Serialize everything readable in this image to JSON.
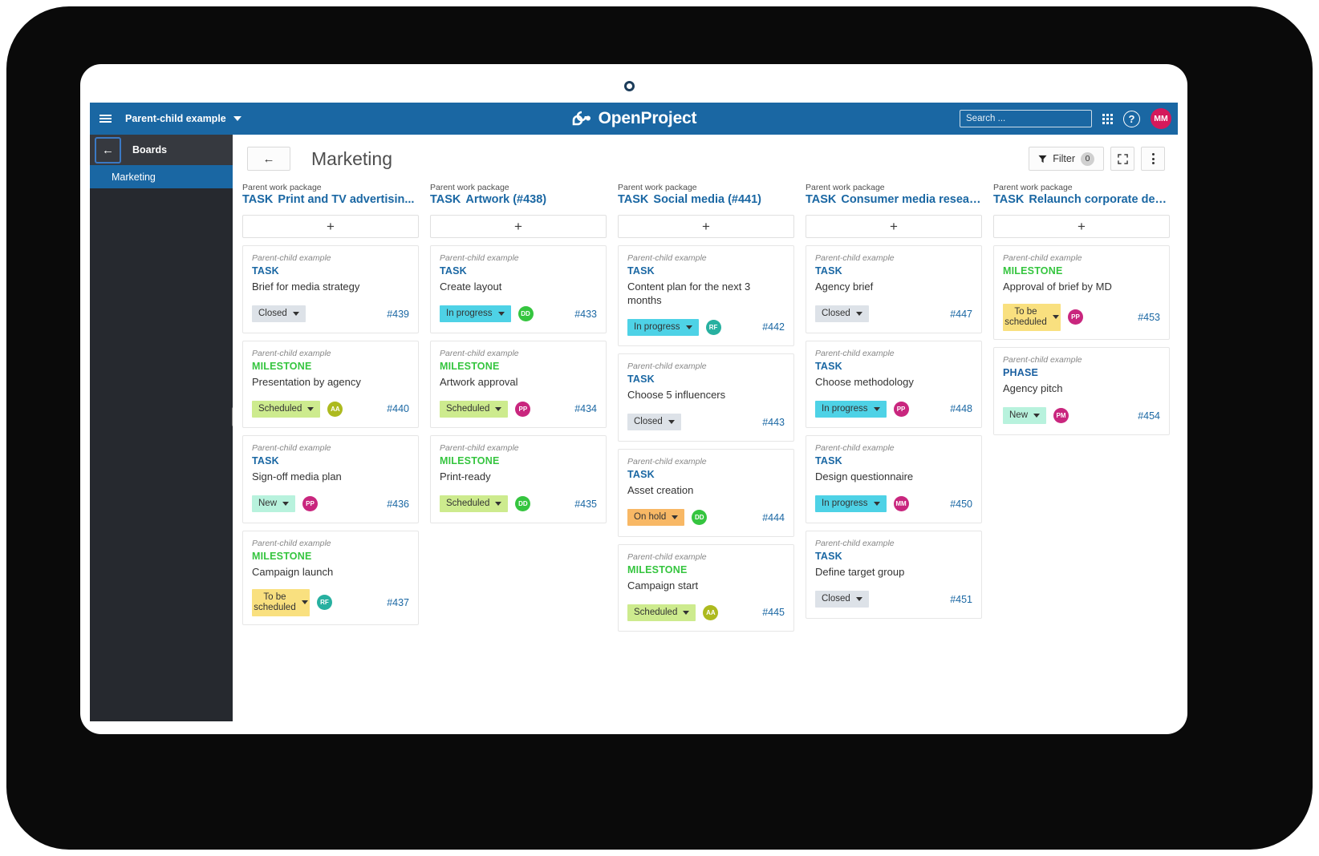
{
  "topbar": {
    "project_name": "Parent-child example",
    "brand_name": "OpenProject",
    "search_placeholder": "Search ...",
    "help_label": "?",
    "user_initials": "MM",
    "user_avatar_color": "#d4195b"
  },
  "sidebar": {
    "title": "Boards",
    "back_arrow": "←",
    "items": [
      {
        "label": "Marketing",
        "active": true
      }
    ]
  },
  "toolbar": {
    "back_arrow": "←",
    "page_title": "Marketing",
    "filter_label": "Filter",
    "filter_count": "0",
    "fullscreen_label": "",
    "more_label": ""
  },
  "board": {
    "parent_kicker": "Parent work package",
    "add_card_label": "+",
    "columns": [
      {
        "kicker": "Parent work package",
        "type_prefix": "TASK",
        "title": "Print and TV advertisin...",
        "cards": [
          {
            "project": "Parent-child example",
            "type": "TASK",
            "subject": "Brief for media strategy",
            "status": "Closed",
            "status_color": "#dde2e8",
            "avatar": null,
            "avatar_color": null,
            "id": "#439"
          },
          {
            "project": "Parent-child example",
            "type": "MILESTONE",
            "subject": "Presentation by agency",
            "status": "Scheduled",
            "status_color": "#cdeb8e",
            "avatar": "AA",
            "avatar_color": "#adba1f",
            "id": "#440"
          },
          {
            "project": "Parent-child example",
            "type": "TASK",
            "subject": "Sign-off media plan",
            "status": "New",
            "status_color": "#b8f2dd",
            "avatar": "PP",
            "avatar_color": "#c9267e",
            "id": "#436"
          },
          {
            "project": "Parent-child example",
            "type": "MILESTONE",
            "subject": "Campaign launch",
            "status": "To be scheduled",
            "status_color": "#f9e07f",
            "avatar": "RF",
            "avatar_color": "#27b0a0",
            "id": "#437"
          }
        ]
      },
      {
        "kicker": "Parent work package",
        "type_prefix": "TASK",
        "title": "Artwork (#438)",
        "cards": [
          {
            "project": "Parent-child example",
            "type": "TASK",
            "subject": "Create layout",
            "status": "In progress",
            "status_color": "#4ed2e6",
            "avatar": "DD",
            "avatar_color": "#35c53f",
            "id": "#433"
          },
          {
            "project": "Parent-child example",
            "type": "MILESTONE",
            "subject": "Artwork approval",
            "status": "Scheduled",
            "status_color": "#cdeb8e",
            "avatar": "PP",
            "avatar_color": "#c9267e",
            "id": "#434"
          },
          {
            "project": "Parent-child example",
            "type": "MILESTONE",
            "subject": "Print-ready",
            "status": "Scheduled",
            "status_color": "#cdeb8e",
            "avatar": "DD",
            "avatar_color": "#35c53f",
            "id": "#435"
          }
        ]
      },
      {
        "kicker": "Parent work package",
        "type_prefix": "TASK",
        "title": "Social media (#441)",
        "cards": [
          {
            "project": "Parent-child example",
            "type": "TASK",
            "subject": "Content plan for the next 3 months",
            "status": "In progress",
            "status_color": "#4ed2e6",
            "avatar": "RF",
            "avatar_color": "#27b0a0",
            "id": "#442"
          },
          {
            "project": "Parent-child example",
            "type": "TASK",
            "subject": "Choose 5 influencers",
            "status": "Closed",
            "status_color": "#dde2e8",
            "avatar": null,
            "avatar_color": null,
            "id": "#443"
          },
          {
            "project": "Parent-child example",
            "type": "TASK",
            "subject": "Asset creation",
            "status": "On hold",
            "status_color": "#f8b865",
            "avatar": "DD",
            "avatar_color": "#35c53f",
            "id": "#444"
          },
          {
            "project": "Parent-child example",
            "type": "MILESTONE",
            "subject": "Campaign start",
            "status": "Scheduled",
            "status_color": "#cdeb8e",
            "avatar": "AA",
            "avatar_color": "#adba1f",
            "id": "#445"
          }
        ]
      },
      {
        "kicker": "Parent work package",
        "type_prefix": "TASK",
        "title": "Consumer media resear...",
        "cards": [
          {
            "project": "Parent-child example",
            "type": "TASK",
            "subject": "Agency brief",
            "status": "Closed",
            "status_color": "#dde2e8",
            "avatar": null,
            "avatar_color": null,
            "id": "#447"
          },
          {
            "project": "Parent-child example",
            "type": "TASK",
            "subject": "Choose methodology",
            "status": "In progress",
            "status_color": "#4ed2e6",
            "avatar": "PP",
            "avatar_color": "#c9267e",
            "id": "#448"
          },
          {
            "project": "Parent-child example",
            "type": "TASK",
            "subject": "Design questionnaire",
            "status": "In progress",
            "status_color": "#4ed2e6",
            "avatar": "MM",
            "avatar_color": "#c9267e",
            "id": "#450"
          },
          {
            "project": "Parent-child example",
            "type": "TASK",
            "subject": "Define target group",
            "status": "Closed",
            "status_color": "#dde2e8",
            "avatar": null,
            "avatar_color": null,
            "id": "#451"
          }
        ]
      },
      {
        "kicker": "Parent work package",
        "type_prefix": "TASK",
        "title": "Relaunch corporate des...",
        "cards": [
          {
            "project": "Parent-child example",
            "type": "MILESTONE",
            "subject": "Approval of brief by MD",
            "status": "To be scheduled",
            "status_color": "#f9e07f",
            "avatar": "PP",
            "avatar_color": "#c9267e",
            "id": "#453"
          },
          {
            "project": "Parent-child example",
            "type": "PHASE",
            "subject": "Agency pitch",
            "status": "New",
            "status_color": "#b8f2dd",
            "avatar": "PM",
            "avatar_color": "#c9267e",
            "id": "#454"
          }
        ]
      }
    ]
  }
}
